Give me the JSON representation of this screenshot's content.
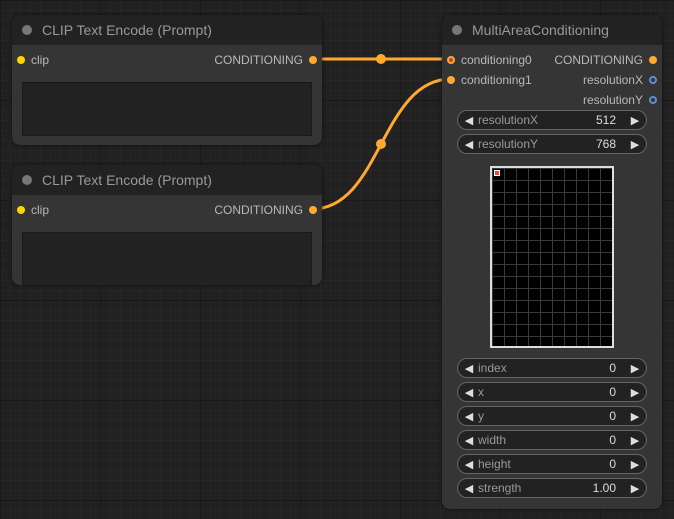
{
  "nodes": {
    "clip1": {
      "title": "CLIP Text Encode (Prompt)",
      "input_label": "clip",
      "output_label": "CONDITIONING",
      "text_value": ""
    },
    "clip2": {
      "title": "CLIP Text Encode (Prompt)",
      "input_label": "clip",
      "output_label": "CONDITIONING",
      "text_value": ""
    },
    "multi": {
      "title": "MultiAreaConditioning",
      "inputs": [
        "conditioning0",
        "conditioning1"
      ],
      "outputs": [
        "CONDITIONING",
        "resolutionX",
        "resolutionY"
      ],
      "widgets": [
        {
          "label": "resolutionX",
          "value": "512"
        },
        {
          "label": "resolutionY",
          "value": "768"
        },
        {
          "label": "index",
          "value": "0"
        },
        {
          "label": "x",
          "value": "0"
        },
        {
          "label": "y",
          "value": "0"
        },
        {
          "label": "width",
          "value": "0"
        },
        {
          "label": "height",
          "value": "0"
        },
        {
          "label": "strength",
          "value": "1.00"
        }
      ]
    }
  },
  "icons": {
    "arrow_left": "◀",
    "arrow_right": "▶"
  },
  "colors": {
    "link": "#ffa931",
    "clip_slot": "#ffd500",
    "conditioning_slot": "#ffa931",
    "int_slot": "#5b8fd6"
  }
}
